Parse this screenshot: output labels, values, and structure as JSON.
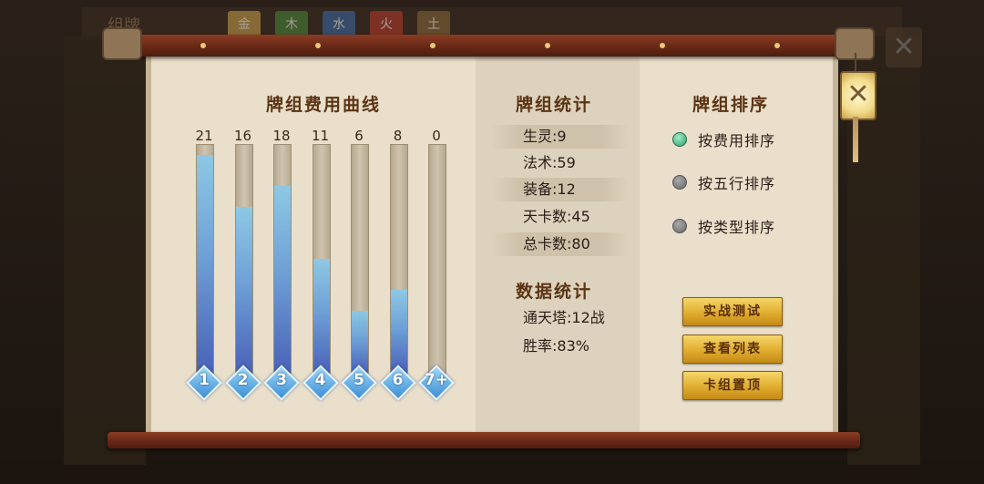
{
  "background": {
    "tabs": [
      "金",
      "木",
      "水",
      "火",
      "土"
    ],
    "tab_colors": [
      "#c9a24a",
      "#4a8a3a",
      "#3a6aaa",
      "#b83a2a",
      "#8a6a3a"
    ],
    "left_title": "组牌"
  },
  "cost_curve": {
    "title": "牌组费用曲线"
  },
  "chart_data": {
    "type": "bar",
    "categories": [
      "1",
      "2",
      "3",
      "4",
      "5",
      "6",
      "7+"
    ],
    "values": [
      21,
      16,
      18,
      11,
      6,
      8,
      0
    ],
    "ylim": [
      0,
      22
    ]
  },
  "deck_stats": {
    "title": "牌组统计",
    "rows": [
      "生灵:9",
      "法术:59",
      "装备:12",
      "天卡数:45",
      "总卡数:80"
    ]
  },
  "data_stats": {
    "title": "数据统计",
    "rows": [
      "通天塔:12战",
      "胜率:83%"
    ]
  },
  "deck_sort": {
    "title": "牌组排序",
    "options": [
      {
        "label": "按费用排序",
        "selected": true
      },
      {
        "label": "按五行排序",
        "selected": false
      },
      {
        "label": "按类型排序",
        "selected": false
      }
    ]
  },
  "buttons": {
    "test": "实战测试",
    "view_list": "查看列表",
    "pin": "卡组置顶"
  },
  "close_icon": "close-icon"
}
